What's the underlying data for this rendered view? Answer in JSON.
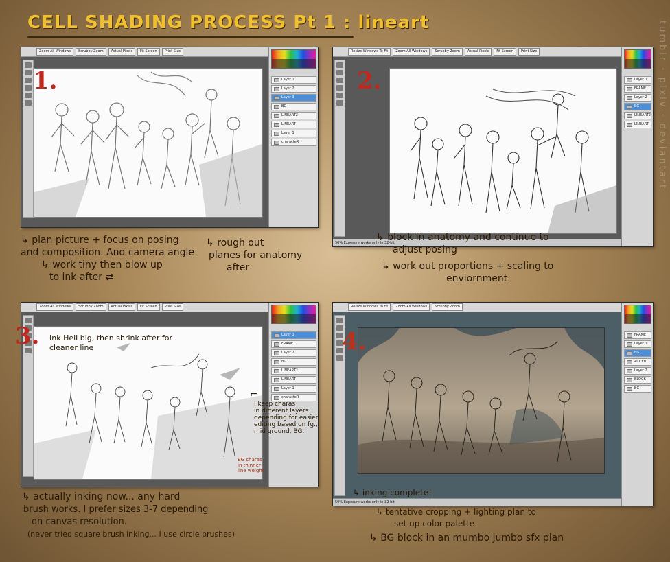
{
  "title": "CELL SHADING PROCESS Pt 1 : lineart",
  "watermark": "tumblr · pixiv · deviantart",
  "app_ui": {
    "toolbar_buttons_a": [
      "Zoom All Windows",
      "Scrubby Zoom",
      "Actual Pixels",
      "Fit Screen",
      "Print Size"
    ],
    "toolbar_buttons_b": [
      "Resize Windows To Fit",
      "Zoom All Windows",
      "Scrubby Zoom",
      "Actual Pixels",
      "Fit Screen",
      "Print Size"
    ],
    "status_text": "50% Exposure works only in 32-bit",
    "layers_1": [
      "Layer 1",
      "Layer 2",
      "Layer 3",
      "BG",
      "LINEART2",
      "LINEART",
      "Layer 1",
      "characteR"
    ],
    "layers_2": [
      "Layer 1",
      "FRAME",
      "Layer 2",
      "BG",
      "LINEART2",
      "LINEART"
    ],
    "layers_3": [
      "Layer 1",
      "FRAME",
      "Layer 2",
      "BG",
      "LINEART2",
      "LINEART",
      "Layer 1",
      "characteR"
    ],
    "layers_4": [
      "FRAME",
      "Layer 1",
      "BG",
      "ACCENT",
      "Layer 2",
      "BLOCK",
      "BG"
    ],
    "selected_color": "#4d8fd6"
  },
  "panels": [
    {
      "number": "1.",
      "notes": [
        "plan picture + focus on posing",
        "and composition. And camera angle",
        "work tiny then blow up",
        "to ink after"
      ],
      "side_note": [
        "rough out",
        "planes for anatomy",
        "after"
      ]
    },
    {
      "number": "2.",
      "notes": [
        "block in anatomy and continue to",
        "adjust posing",
        "work out proportions + scaling to",
        "enviornment"
      ]
    },
    {
      "number": "3.",
      "top_note": [
        "Ink Hell big, then shrink after for",
        "cleaner line"
      ],
      "side_note": [
        "I keep charas",
        "in different layers",
        "depending for easier",
        "editing based on fg.,",
        "mid ground, BG."
      ],
      "tiny_note": [
        "BG charas",
        "in thinner",
        "line weight"
      ],
      "notes": [
        "actually inking now... any hard",
        "brush works. I prefer sizes 3-7 depending",
        "on canvas resolution.",
        "(never tried square brush inking... I use circle brushes)"
      ]
    },
    {
      "number": "4.",
      "notes": [
        "inking complete!",
        "tentative cropping + lighting plan to",
        "set up color palette",
        "BG block in an mumbo jumbo sfx plan"
      ]
    }
  ]
}
